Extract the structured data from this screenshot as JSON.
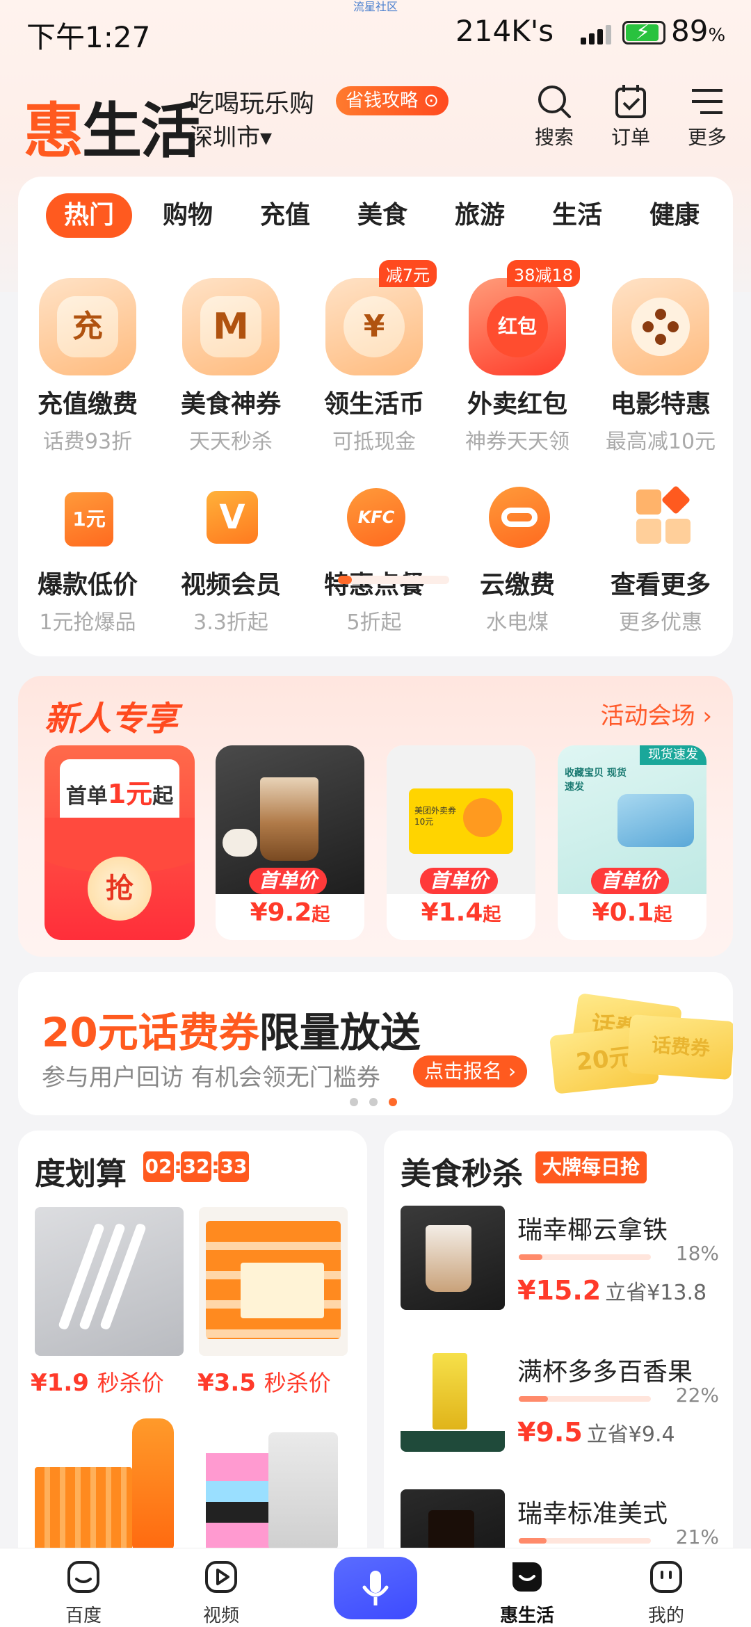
{
  "status": {
    "time": "下午1:27",
    "net": "214K's",
    "battery": "89",
    "battery_unit": "%",
    "top_tag": "流星社区"
  },
  "header": {
    "logo_hui": "惠",
    "logo_rest": "生活",
    "slogan": "吃喝玩乐购",
    "city": "深圳市▾",
    "save_guide": "省钱攻略 ⊙",
    "actions": [
      {
        "icon": "search-icon",
        "label": "搜索"
      },
      {
        "icon": "order-icon",
        "label": "订单"
      },
      {
        "icon": "menu-icon",
        "label": "更多"
      }
    ]
  },
  "tabs": [
    "热门",
    "购物",
    "充值",
    "美食",
    "旅游",
    "生活",
    "健康"
  ],
  "grid_row1": [
    {
      "icon": "recharge-icon",
      "glyph": "充",
      "name": "充值缴费",
      "sub": "话费93折"
    },
    {
      "icon": "mcdonalds-icon",
      "glyph": "M",
      "name": "美食神券",
      "sub": "天天秒杀"
    },
    {
      "icon": "yuan-coin-icon",
      "glyph": "¥",
      "name": "领生活币",
      "sub": "可抵现金",
      "badge": "减7元"
    },
    {
      "icon": "red-packet-icon",
      "glyph": "红包",
      "name": "外卖红包",
      "sub": "神券天天领",
      "badge": "38减18"
    },
    {
      "icon": "film-reel-icon",
      "glyph": "●",
      "name": "电影特惠",
      "sub": "最高减10元"
    }
  ],
  "grid_row2": [
    {
      "icon": "one-yuan-icon",
      "glyph": "1元",
      "name": "爆款低价",
      "sub": "1元抢爆品"
    },
    {
      "icon": "video-vip-icon",
      "glyph": "V",
      "name": "视频会员",
      "sub": "3.3折起"
    },
    {
      "icon": "kfc-icon",
      "glyph": "KFC",
      "name": "特惠点餐",
      "sub": "5折起"
    },
    {
      "icon": "cloud-pay-icon",
      "glyph": "",
      "name": "云缴费",
      "sub": "水电煤"
    },
    {
      "icon": "grid-more-icon",
      "glyph": "",
      "name": "查看更多",
      "sub": "更多优惠"
    }
  ],
  "newuser": {
    "title": "新人专享",
    "more": "活动会场 ›",
    "redpack_pre": "首单",
    "redpack_num": "1元",
    "redpack_post": "起",
    "grab": "抢",
    "coupon_text": "美团外卖券10元",
    "tray_label": "现货速发",
    "mask_box_text": "收藏宝贝 现货速发",
    "products": [
      {
        "name": "coffee",
        "tag": "首单价",
        "price": "¥9.2",
        "suffix": "起"
      },
      {
        "name": "coupon",
        "tag": "首单价",
        "price": "¥1.4",
        "suffix": "起"
      },
      {
        "name": "mask",
        "tag": "首单价",
        "price": "¥0.1",
        "suffix": "起"
      }
    ]
  },
  "banner": {
    "highlight": "20元话费券",
    "rest": "限量放送",
    "sub": "参与用户回访 有机会领无门槛券",
    "btn": "点击报名 ›",
    "ticket1": "20元",
    "ticket2": "话费券"
  },
  "deals": {
    "title": "度划算",
    "timer": [
      "02",
      "32",
      "33"
    ],
    "items": [
      {
        "price": "¥1.9",
        "label": "秒杀价"
      },
      {
        "price": "¥3.5",
        "label": "秒杀价"
      }
    ]
  },
  "food": {
    "title": "美食秒杀",
    "tag": "大牌每日抢",
    "items": [
      {
        "name": "瑞幸椰云拿铁",
        "pct": "18%",
        "sold_fraction": 0.18,
        "price": "¥15.2",
        "save": "立省¥13.8"
      },
      {
        "name": "满杯多多百香果",
        "pct": "22%",
        "sold_fraction": 0.22,
        "price": "¥9.5",
        "save": "立省¥9.4"
      },
      {
        "name": "瑞幸标准美式",
        "pct": "21%",
        "sold_fraction": 0.21,
        "price": "",
        "save": ""
      }
    ]
  },
  "nav": [
    {
      "icon": "baidu-icon",
      "label": "百度"
    },
    {
      "icon": "video-icon",
      "label": "视频"
    },
    {
      "icon": "mic-icon",
      "label": ""
    },
    {
      "icon": "huishenghuo-icon",
      "label": "惠生活"
    },
    {
      "icon": "profile-icon",
      "label": "我的"
    }
  ]
}
